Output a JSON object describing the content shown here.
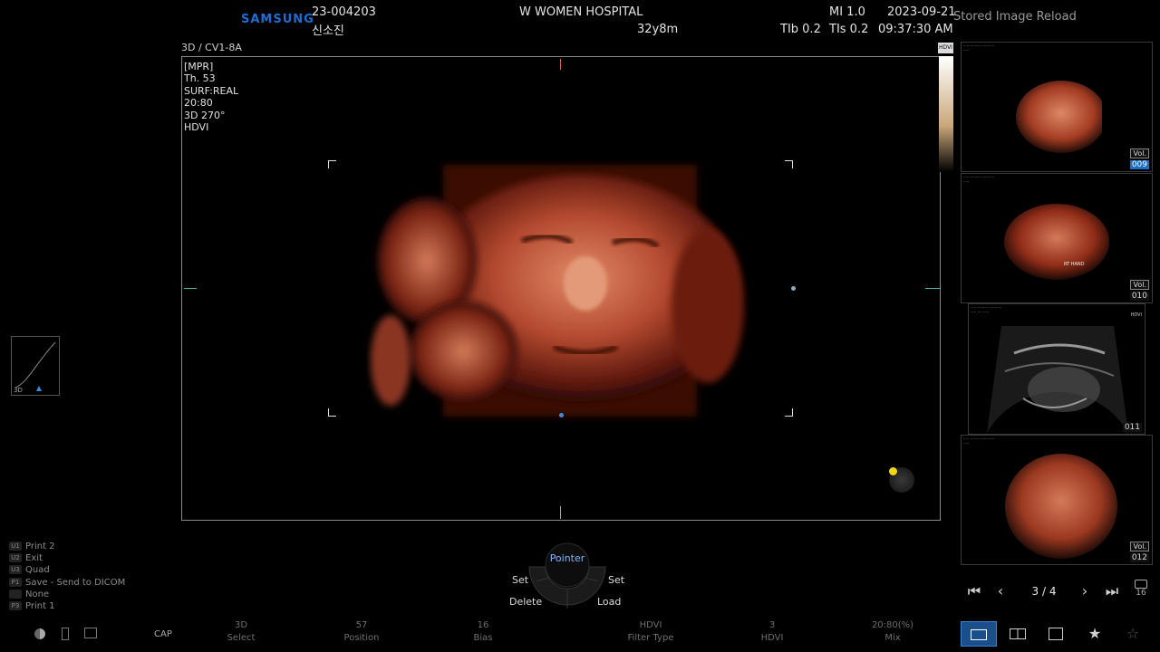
{
  "header": {
    "brand": "SAMSUNG",
    "patient_id": "23-004203",
    "patient_name": "신소진",
    "hospital": "W WOMEN HOSPITAL",
    "age": "32y8m",
    "mi": "MI 1.0",
    "tib": "TIb 0.2",
    "tis": "TIs 0.2",
    "date": "2023-09-21",
    "time": "09:37:30 AM",
    "stored_image_reload": "Stored Image Reload"
  },
  "probe_label": "3D / CV1-8A",
  "image_info": [
    "[MPR]",
    "Th. 53",
    "SURF:REAL",
    "20:80",
    "3D 270°",
    "HDVI"
  ],
  "curve_widget_label": "3D",
  "thumbnails": [
    {
      "label": "Vol.",
      "number": "009",
      "selected": true
    },
    {
      "label": "Vol.",
      "number": "010",
      "selected": false,
      "annotation": "RT HAND"
    },
    {
      "label": "",
      "number": "011",
      "selected": false
    },
    {
      "label": "Vol.",
      "number": "012",
      "selected": false
    }
  ],
  "thumb_nav": {
    "page": "3 / 4",
    "count": "16"
  },
  "user_keys": [
    {
      "key": "U1",
      "label": "Print 2"
    },
    {
      "key": "U2",
      "label": "Exit"
    },
    {
      "key": "U3",
      "label": "Quad"
    },
    {
      "key": "P1",
      "label": "Save - Send to DICOM"
    },
    {
      "key": "",
      "label": "None"
    },
    {
      "key": "P3",
      "label": "Print 1"
    }
  ],
  "trackball": {
    "center": "Pointer",
    "top_left": "Set",
    "top_right": "Set",
    "bottom_left": "Delete",
    "bottom_right": "Load"
  },
  "cap_label": "CAP",
  "bottom_params": [
    {
      "value": "3D",
      "name": "Select"
    },
    {
      "value": "57",
      "name": "Position"
    },
    {
      "value": "16",
      "name": "Bias"
    },
    {
      "value": "HDVI",
      "name": "Filter Type"
    },
    {
      "value": "3",
      "name": "HDVI"
    },
    {
      "value": "20:80(%)",
      "name": "Mix"
    }
  ],
  "hdvi_badge": "HDVI",
  "colors": {
    "background": "#000000",
    "brand_blue": "#1b6fd0",
    "selected_thumb": "#1a6fc4",
    "pointer_blue": "#7fb6ff",
    "rendering_skin": "#c2583f"
  }
}
